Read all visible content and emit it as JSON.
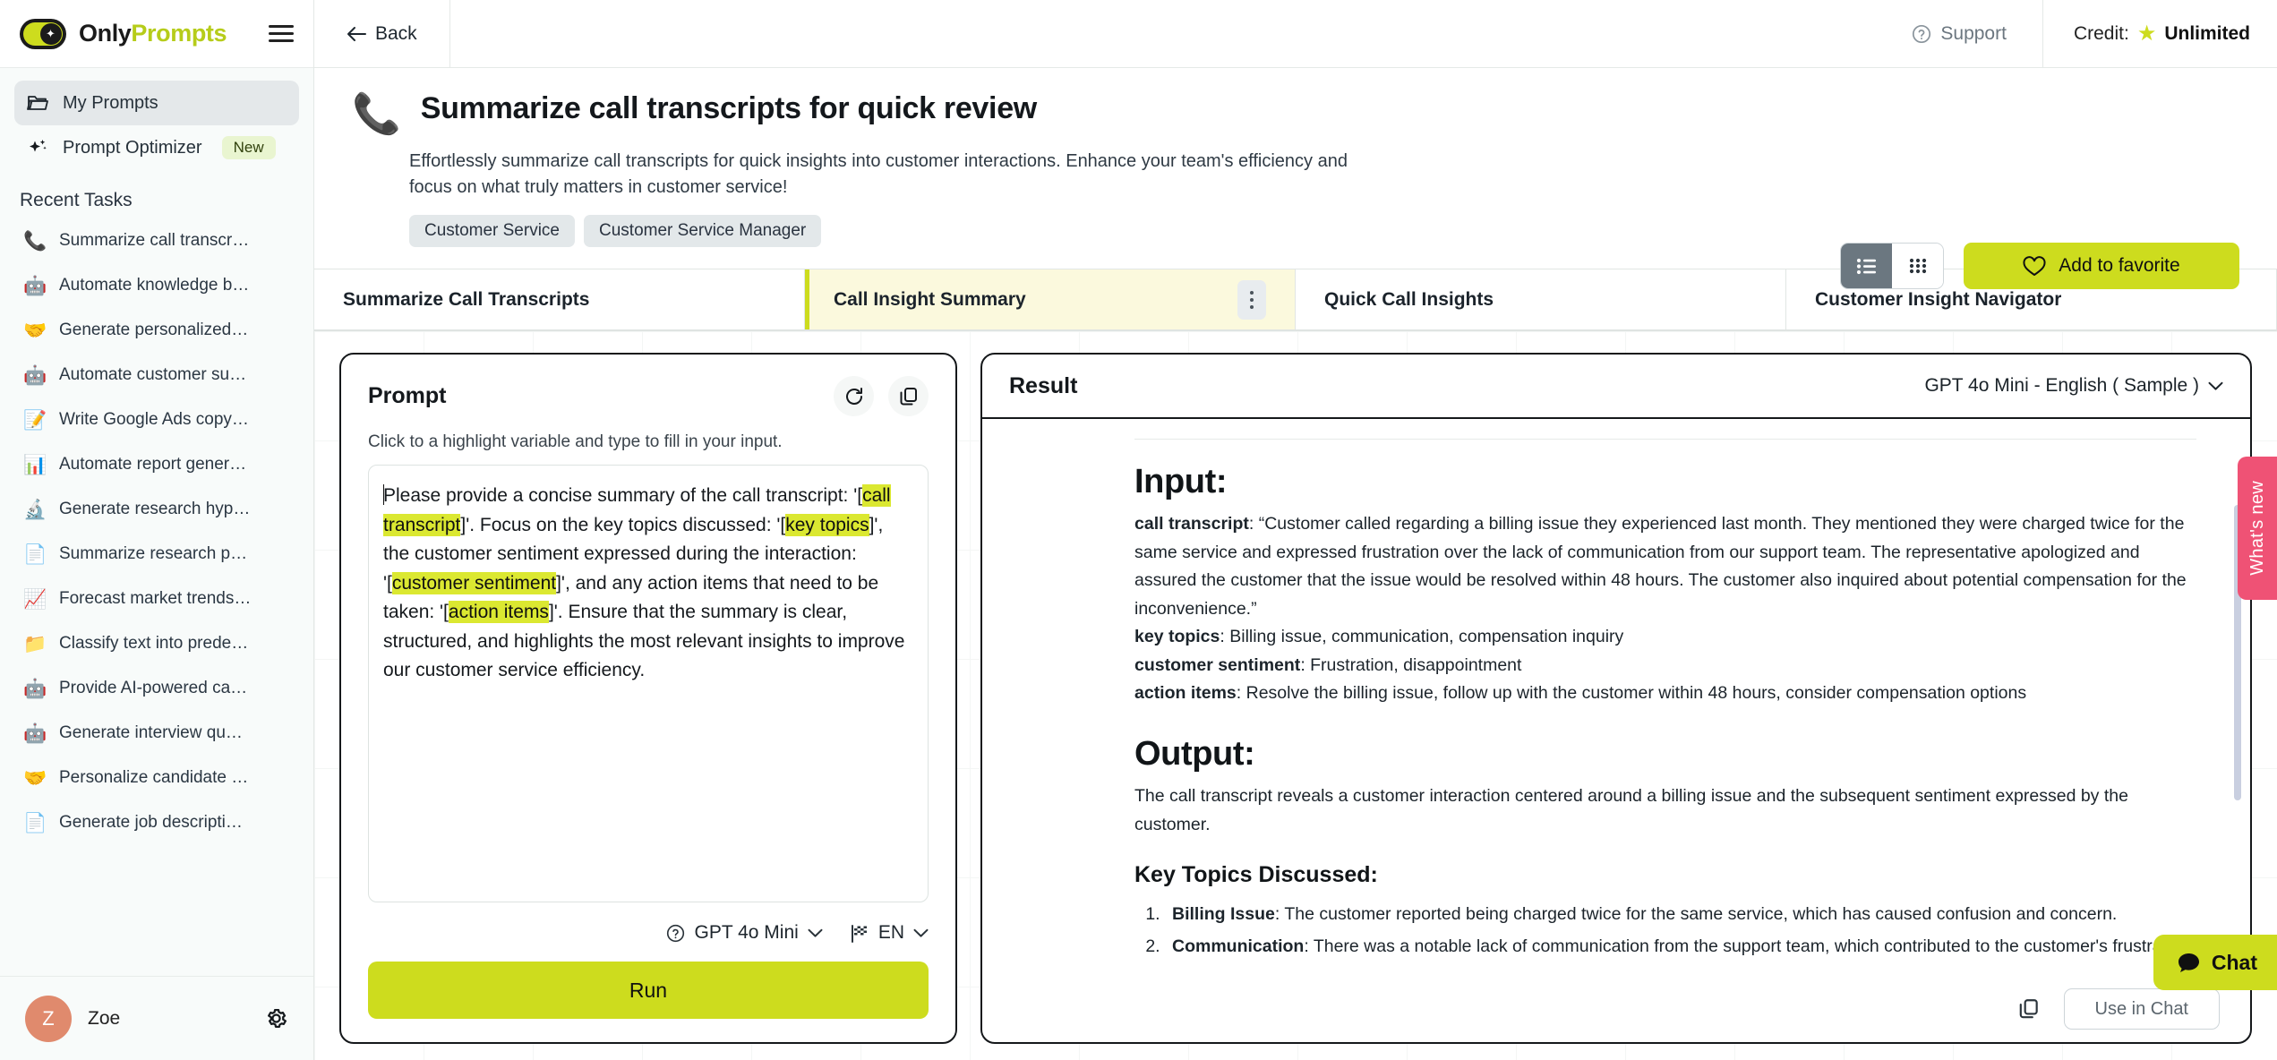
{
  "brand": {
    "name_part1": "Only",
    "name_part2": "Prompts"
  },
  "topbar": {
    "back_label": "Back",
    "support_label": "Support",
    "credit_label": "Credit:",
    "credit_value": "Unlimited"
  },
  "sidebar": {
    "my_prompts": "My Prompts",
    "prompt_optimizer": "Prompt Optimizer",
    "optimizer_badge": "New",
    "section_title": "Recent Tasks",
    "tasks": [
      {
        "icon": "📞",
        "label": "Summarize call transcrip..."
      },
      {
        "icon": "🤖",
        "label": "Automate knowledge ba..."
      },
      {
        "icon": "🤝",
        "label": "Generate personalized r..."
      },
      {
        "icon": "🤖",
        "label": "Automate customer sup..."
      },
      {
        "icon": "📝",
        "label": "Write Google Ads copy v..."
      },
      {
        "icon": "📊",
        "label": "Automate report generat..."
      },
      {
        "icon": "🔬",
        "label": "Generate research hypot..."
      },
      {
        "icon": "📄",
        "label": "Summarize research pap..."
      },
      {
        "icon": "📈",
        "label": "Forecast market trends ..."
      },
      {
        "icon": "📁",
        "label": "Classify text into predefi..."
      },
      {
        "icon": "🤖",
        "label": "Provide AI-powered cand..."
      },
      {
        "icon": "🤖",
        "label": "Generate interview ques..."
      },
      {
        "icon": "🤝",
        "label": "Personalize candidate o..."
      },
      {
        "icon": "📄",
        "label": "Generate job description..."
      }
    ],
    "user_initial": "Z",
    "user_name": "Zoe"
  },
  "page": {
    "emoji": "📞",
    "title": "Summarize call transcripts for quick review",
    "description": "Effortlessly summarize call transcripts for quick insights into customer interactions. Enhance your team's efficiency and focus on what truly matters in customer service!",
    "tags": [
      "Customer Service",
      "Customer Service Manager"
    ],
    "favorite_label": "Add to favorite"
  },
  "tabs": [
    {
      "label": "Summarize Call Transcripts",
      "active": false
    },
    {
      "label": "Call Insight Summary",
      "active": true
    },
    {
      "label": "Quick Call Insights",
      "active": false
    },
    {
      "label": "Customer Insight Navigator",
      "active": false
    }
  ],
  "prompt": {
    "title": "Prompt",
    "hint": "Click to a highlight variable and type to fill in your input.",
    "segments": [
      {
        "t": "Please provide a concise summary of the call transcript: '[",
        "h": false
      },
      {
        "t": "call transcript",
        "h": true
      },
      {
        "t": "]'. Focus on the key topics discussed: '[",
        "h": false
      },
      {
        "t": "key topics",
        "h": true
      },
      {
        "t": "]', the customer sentiment expressed during the interaction: '[",
        "h": false
      },
      {
        "t": "customer sentiment",
        "h": true
      },
      {
        "t": "]', and any action items that need to be taken: '[",
        "h": false
      },
      {
        "t": "action items",
        "h": true
      },
      {
        "t": "]'. Ensure that the summary is clear, structured, and highlights the most relevant insights to improve our customer service efficiency.",
        "h": false
      }
    ],
    "model_label": "GPT 4o Mini",
    "language_label": "EN",
    "run_label": "Run"
  },
  "result": {
    "title": "Result",
    "model_label": "GPT 4o Mini - English ( Sample )",
    "input_heading": "Input:",
    "input_fields": [
      {
        "key": "call transcript",
        "sep": ": ",
        "value": "“Customer called regarding a billing issue they experienced last month. They mentioned they were charged twice for the same service and expressed frustration over the lack of communication from our support team. The representative apologized and assured the customer that the issue would be resolved within 48 hours. The customer also inquired about potential compensation for the inconvenience.”"
      },
      {
        "key": "key topics",
        "sep": ": ",
        "value": "Billing issue, communication, compensation inquiry"
      },
      {
        "key": "customer sentiment",
        "sep": ": ",
        "value": "Frustration, disappointment"
      },
      {
        "key": "action items",
        "sep": ": ",
        "value": "Resolve the billing issue, follow up with the customer within 48 hours, consider compensation options"
      }
    ],
    "output_heading": "Output:",
    "output_intro": "The call transcript reveals a customer interaction centered around a billing issue and the subsequent sentiment expressed by the customer.",
    "output_subheading": "Key Topics Discussed:",
    "output_items": [
      {
        "key": "Billing Issue",
        "sep": ": ",
        "value": "The customer reported being charged twice for the same service, which has caused confusion and concern."
      },
      {
        "key": "Communication",
        "sep": ": ",
        "value": "There was a notable lack of communication from the support team, which contributed to the customer's frustration."
      }
    ],
    "use_in_chat_label": "Use in Chat"
  },
  "widgets": {
    "whats_new": "What's new",
    "chat": "Chat"
  },
  "colors": {
    "accent": "#cddc1e",
    "accent_soft": "#fbf9dd",
    "pink": "#ef5275",
    "avatar": "#e08a6d"
  }
}
